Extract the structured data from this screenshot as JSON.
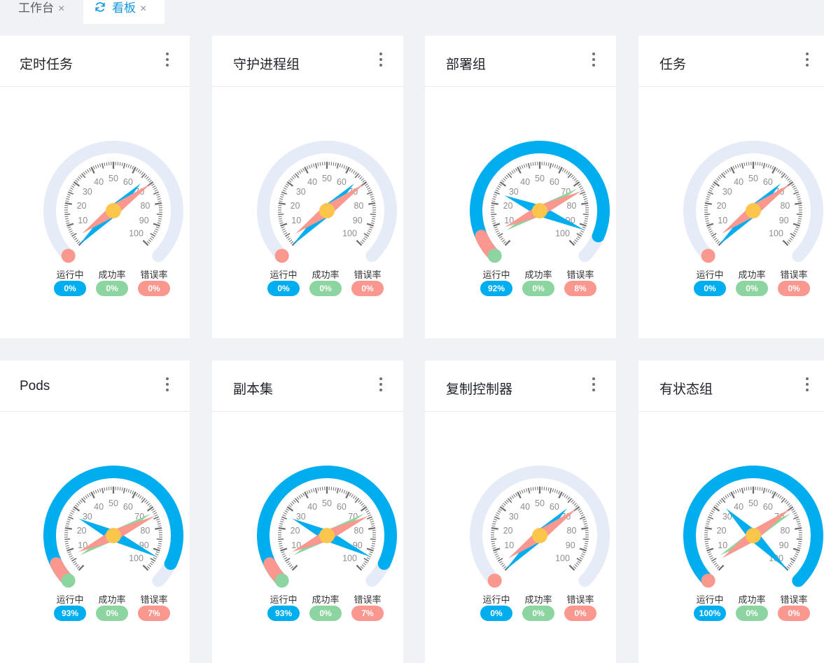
{
  "tabs": [
    {
      "label": "工作台",
      "close": "×",
      "active": false
    },
    {
      "label": "看板",
      "close": "×",
      "active": true,
      "icon": "refresh-icon"
    }
  ],
  "legend": {
    "running": "运行中",
    "success": "成功率",
    "error": "错误率"
  },
  "colors": {
    "running": "#00aeef",
    "success": "#8dd5a0",
    "error": "#fa9890",
    "track": "#e6ecf7",
    "hub": "#fbc64b"
  },
  "gauge_ticks": [
    "10",
    "20",
    "30",
    "40",
    "50",
    "60",
    "70",
    "80",
    "90",
    "100"
  ],
  "cards": [
    {
      "title": "定时任务",
      "running": "0%",
      "success": "0%",
      "error": "0%",
      "running_value": 0,
      "success_value": 0,
      "error_value": 0
    },
    {
      "title": "守护进程组",
      "running": "0%",
      "success": "0%",
      "error": "0%",
      "running_value": 0,
      "success_value": 0,
      "error_value": 0
    },
    {
      "title": "部署组",
      "running": "92%",
      "success": "0%",
      "error": "8%",
      "running_value": 92,
      "success_value": 0,
      "error_value": 8
    },
    {
      "title": "任务",
      "running": "0%",
      "success": "0%",
      "error": "0%",
      "running_value": 0,
      "success_value": 0,
      "error_value": 0
    },
    {
      "title": "Pods",
      "running": "93%",
      "success": "0%",
      "error": "7%",
      "running_value": 93,
      "success_value": 0,
      "error_value": 7
    },
    {
      "title": "副本集",
      "running": "93%",
      "success": "0%",
      "error": "7%",
      "running_value": 93,
      "success_value": 0,
      "error_value": 7
    },
    {
      "title": "复制控制器",
      "running": "0%",
      "success": "0%",
      "error": "0%",
      "running_value": 0,
      "success_value": 0,
      "error_value": 0
    },
    {
      "title": "有状态组",
      "running": "100%",
      "success": "0%",
      "error": "0%",
      "running_value": 100,
      "success_value": 0,
      "error_value": 0
    }
  ]
}
